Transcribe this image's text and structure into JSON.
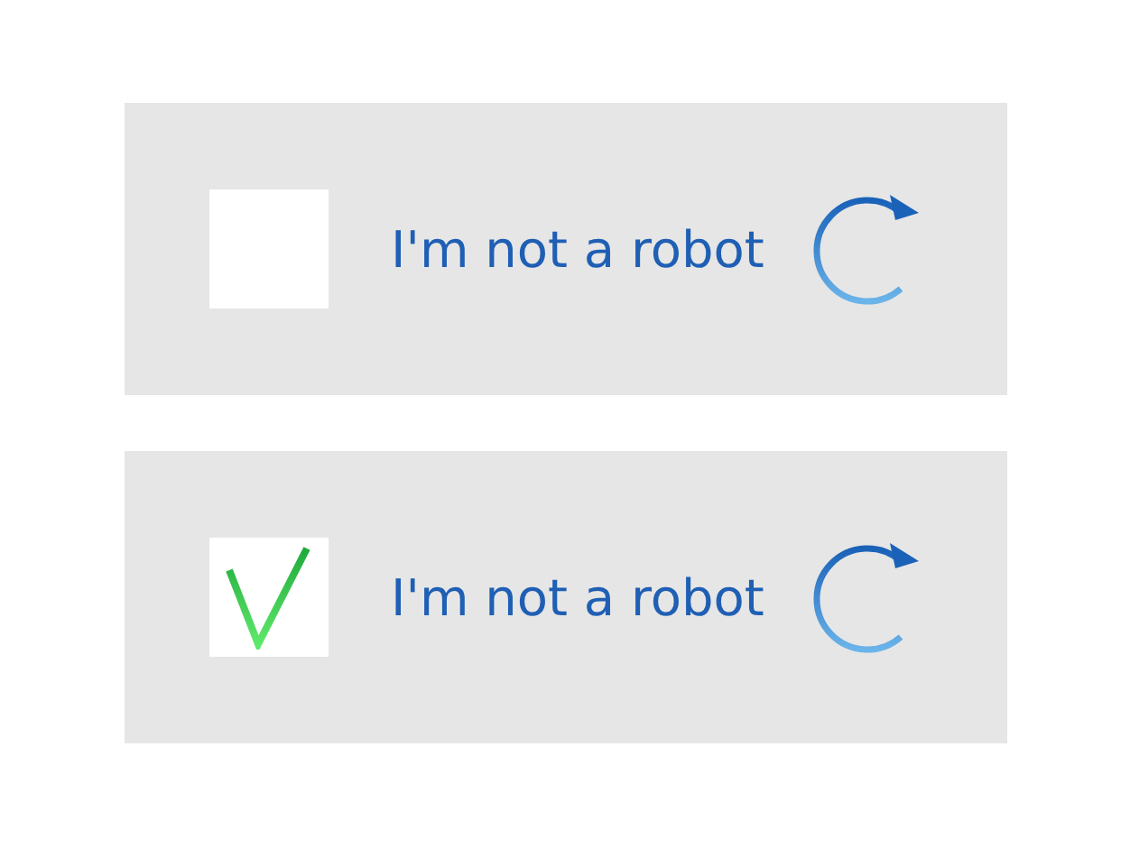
{
  "captchas": [
    {
      "checked": false,
      "label": "I'm not a robot"
    },
    {
      "checked": true,
      "label": "I'm not a robot"
    }
  ]
}
